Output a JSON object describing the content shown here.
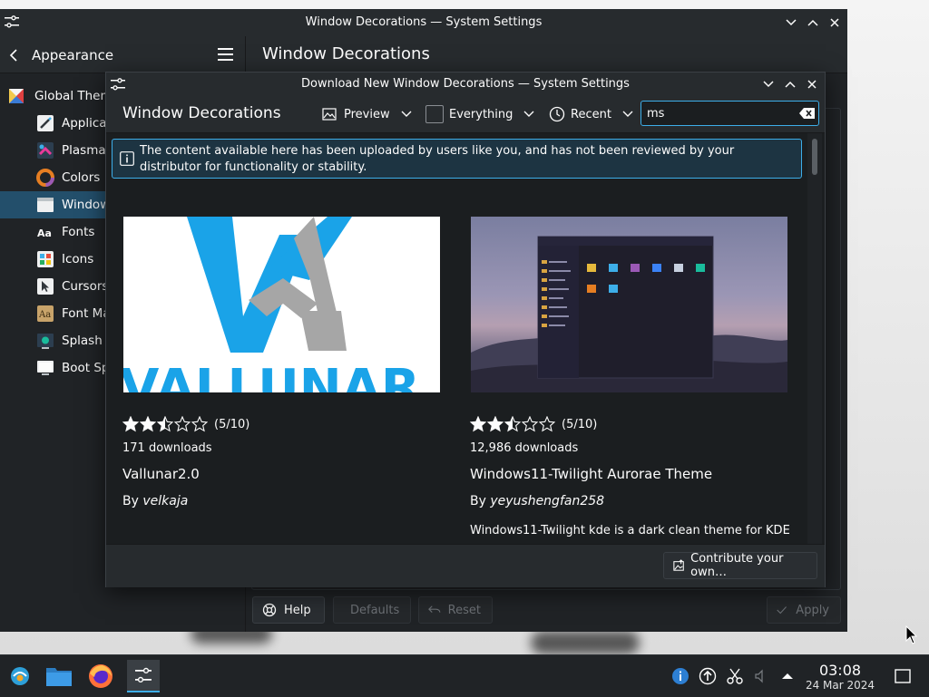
{
  "main_window": {
    "title": "Window Decorations — System Settings",
    "back_label": "Appearance",
    "page_title": "Window Decorations",
    "sidebar": [
      {
        "label": "Global Theme",
        "icon": "global-theme-icon"
      },
      {
        "label": "Application Style",
        "icon": "application-style-icon"
      },
      {
        "label": "Plasma Style",
        "icon": "plasma-style-icon"
      },
      {
        "label": "Colors",
        "icon": "colors-icon"
      },
      {
        "label": "Window Decorations",
        "icon": "window-decorations-icon",
        "selected": true
      },
      {
        "label": "Fonts",
        "icon": "fonts-icon"
      },
      {
        "label": "Icons",
        "icon": "icons-icon"
      },
      {
        "label": "Cursors",
        "icon": "cursors-icon"
      },
      {
        "label": "Font Management",
        "icon": "font-management-icon"
      },
      {
        "label": "Splash Screen",
        "icon": "splash-screen-icon"
      },
      {
        "label": "Boot Splash Screen",
        "icon": "boot-splash-icon"
      }
    ],
    "buttons": {
      "help": "Help",
      "defaults": "Defaults",
      "reset": "Reset",
      "apply": "Apply"
    }
  },
  "dialog": {
    "title": "Download New Window Decorations — System Settings",
    "header_title": "Window Decorations",
    "view_mode": "Preview",
    "filter": "Everything",
    "sort": "Recent",
    "search": {
      "value": "ms"
    },
    "notice": "The content available here has been uploaded by users like you, and has not been reviewed by your distributor for functionality or stability.",
    "items": [
      {
        "rating_text": "(5/10)",
        "rating": 5,
        "downloads": "171 downloads",
        "name": "Vallunar2.0",
        "by": "By",
        "author": "velkaja",
        "preview_text": "VALLUNAR",
        "description": ""
      },
      {
        "rating_text": "(5/10)",
        "rating": 5,
        "downloads": "12,986 downloads",
        "name": "Windows11-Twilight Aurorae Theme",
        "by": "By",
        "author": "yeyushengfan258",
        "description": "Windows11-Twilight kde is a dark clean theme for KDE"
      }
    ],
    "contribute_label": "Contribute your own…"
  },
  "taskbar": {
    "apps": [
      "start-menu-icon",
      "file-manager-icon",
      "firefox-icon",
      "system-settings-icon"
    ],
    "clock": {
      "time": "03:08",
      "date": "24 Mar 2024"
    }
  },
  "colors": {
    "accent": "#3daee9",
    "window_bg": "#202326",
    "selection": "#234f6b",
    "star": "#fcfcfc",
    "vallunar_blue": "#1aa3e8",
    "vallunar_gray": "#a6a6a6"
  }
}
